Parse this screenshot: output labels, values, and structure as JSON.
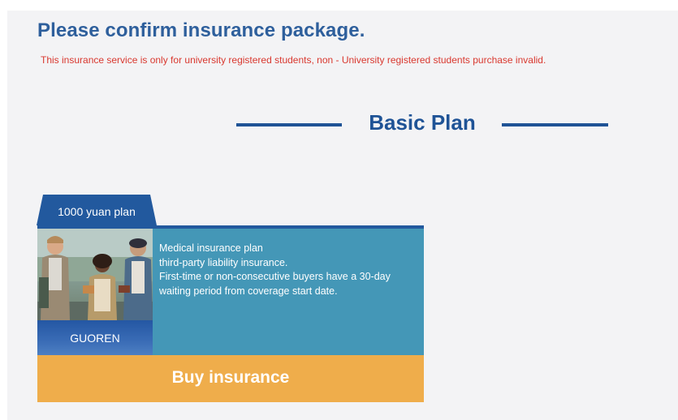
{
  "page": {
    "title": "Please confirm insurance package.",
    "notice": "This insurance service is only for university registered students, non - University registered students purchase invalid."
  },
  "plan_section": {
    "heading": "Basic Plan"
  },
  "plan_card": {
    "tab_label": "1000 yuan plan",
    "brand_label": "GUOREN",
    "photo_icon": "students-photo",
    "description_lines": [
      "Medical insurance plan",
      "third-party liability insurance.",
      "First-time or non-consecutive buyers have a 30-day",
      "waiting period from coverage start date."
    ],
    "buy_label": "Buy insurance"
  },
  "colors": {
    "title": "#2e5f9c",
    "notice": "#d9382f",
    "accent_blue": "#1f5396",
    "card_teal": "#4497b7",
    "buy_orange": "#efad4b",
    "panel_bg": "#f3f3f5"
  }
}
